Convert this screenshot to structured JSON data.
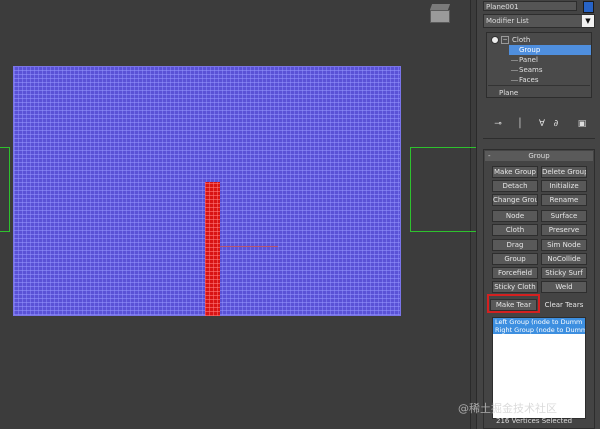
{
  "command_panel": {
    "object_name": "Plane001",
    "color_swatch": "#2763c6",
    "modifier_list_label": "Modifier List",
    "stack": {
      "root": "Cloth",
      "items": [
        "Group",
        "Panel",
        "Seams",
        "Faces"
      ],
      "selected": "Group",
      "base_object": "Plane"
    },
    "group_rollout": {
      "title": "Group",
      "buttons": [
        [
          "Make Group",
          "Delete Group"
        ],
        [
          "Detach",
          "Initialize"
        ],
        [
          "Change Group",
          "Rename"
        ],
        [
          "Node",
          "Surface"
        ],
        [
          "Cloth",
          "Preserve"
        ],
        [
          "Drag",
          "Sim Node"
        ],
        [
          "Group",
          "NoCollide"
        ],
        [
          "Forcefield",
          "Sticky Surf"
        ],
        [
          "Sticky Cloth",
          "Weld"
        ],
        [
          "Make Tear",
          "Clear Tears"
        ]
      ],
      "highlighted_button": "Make Tear",
      "group_list": [
        "Left Group (node  to  Dumm",
        "Right Group (node  to  Dumm"
      ],
      "status_text": "216 Vertices Selected"
    }
  },
  "viewport": {
    "cloth_color": "#5a52d6",
    "tear_color": "#d81414"
  },
  "watermark": "@稀土掘金技术社区"
}
